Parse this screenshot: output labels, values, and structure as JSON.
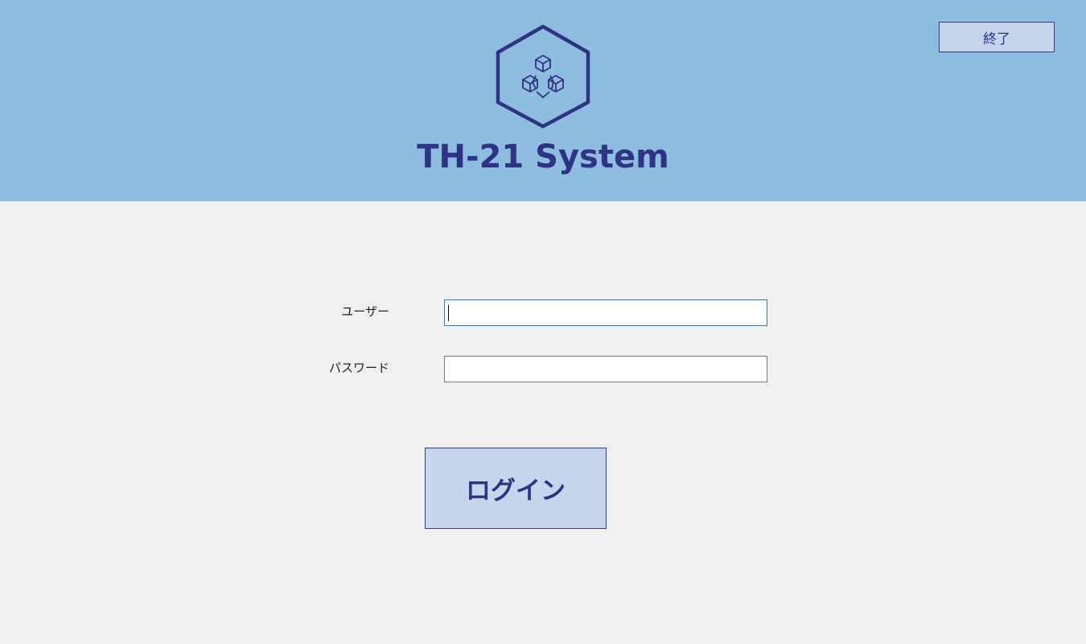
{
  "header": {
    "title": "TH-21 System",
    "logo_icon": "hexagon-network-cubes-icon",
    "background_color": "#8fbddf",
    "accent_color": "#2e3383"
  },
  "toolbar": {
    "exit_label": "終了"
  },
  "login_form": {
    "user_label": "ユーザー",
    "user_value": "",
    "password_label": "パスワード",
    "password_value": "",
    "login_label": "ログイン",
    "button_color": "#c5d5eb"
  }
}
